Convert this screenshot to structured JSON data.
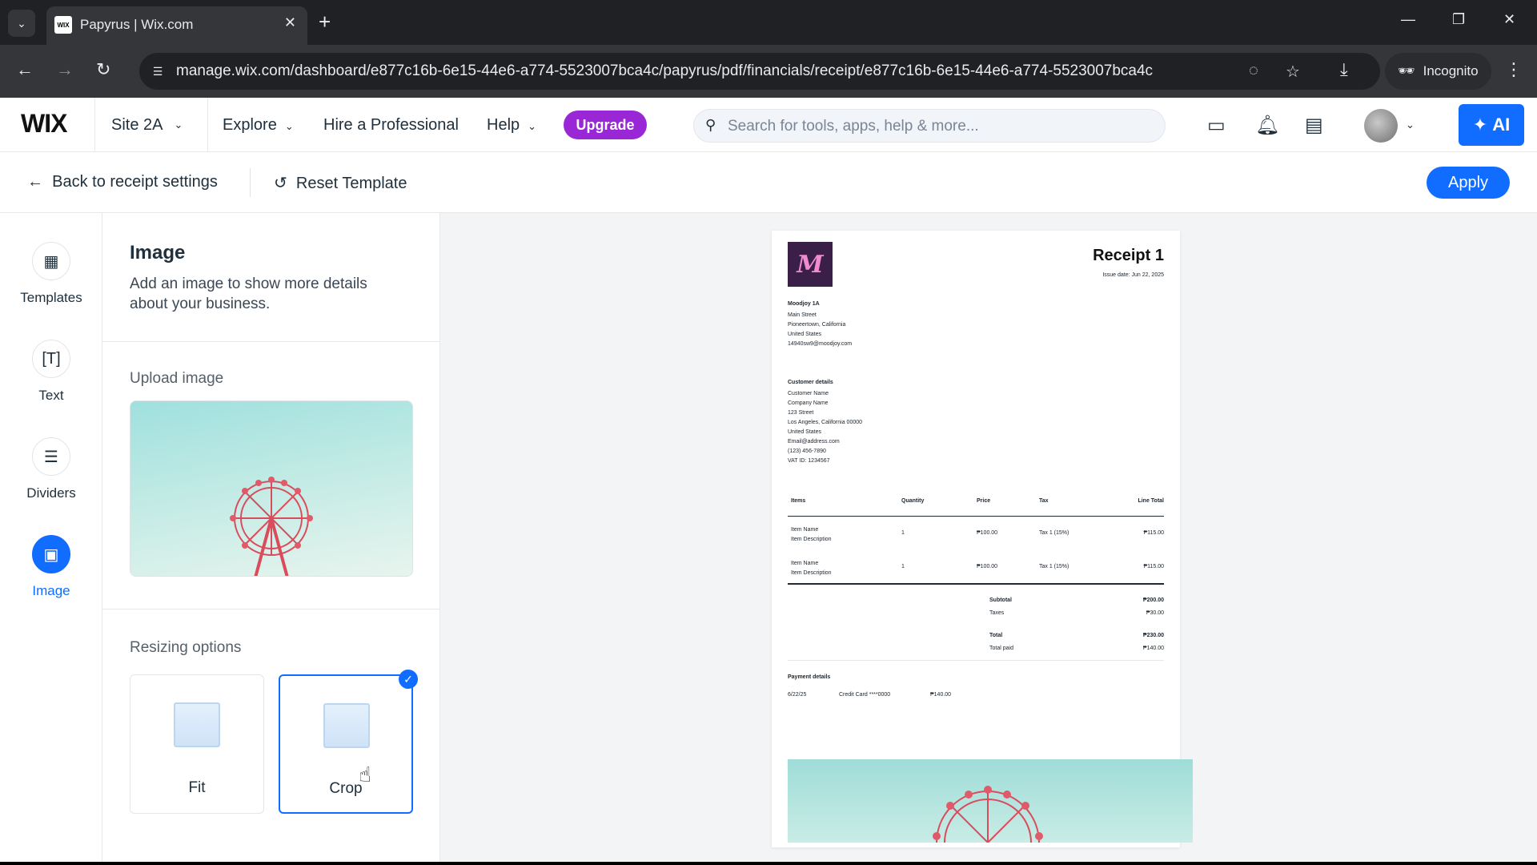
{
  "browser": {
    "tab_title": "Papyrus | Wix.com",
    "tab_favicon": "WIX",
    "url": "manage.wix.com/dashboard/e877c16b-6e15-44e6-a774-5523007bca4c/papyrus/pdf/financials/receipt/e877c16b-6e15-44e6-a774-5523007bca4c",
    "incognito_label": "Incognito"
  },
  "wix": {
    "logo": "WIX",
    "site_name": "Site 2A",
    "menu": {
      "explore": "Explore",
      "hire": "Hire a Professional",
      "help": "Help"
    },
    "upgrade": "Upgrade",
    "search_placeholder": "Search for tools, apps, help & more...",
    "ai_label": "AI",
    "colors": {
      "accent": "#116dff",
      "upgrade": "#9a27d5"
    }
  },
  "subheader": {
    "back": "Back to receipt settings",
    "reset": "Reset Template",
    "apply": "Apply"
  },
  "rail": {
    "items": [
      {
        "label": "Templates",
        "icon": "templates-icon"
      },
      {
        "label": "Text",
        "icon": "text-icon"
      },
      {
        "label": "Dividers",
        "icon": "dividers-icon"
      },
      {
        "label": "Image",
        "icon": "image-icon",
        "active": true
      }
    ]
  },
  "panel": {
    "title": "Image",
    "description": "Add an image to show more details about your business.",
    "upload_label": "Upload image",
    "resizing_label": "Resizing options",
    "options": [
      {
        "label": "Fit",
        "selected": false
      },
      {
        "label": "Crop",
        "selected": true
      }
    ]
  },
  "receipt": {
    "title": "Receipt 1",
    "issue_date": "Issue date: Jun 22, 2025",
    "business": {
      "name": "Moodjoy 1A",
      "lines": [
        "Main Street",
        "Pioneertown, California",
        "United States",
        "14940sw9@moodjoy.com"
      ]
    },
    "customer": {
      "heading": "Customer details",
      "lines": [
        "Customer Name",
        "Company Name",
        "123 Street",
        "Los Angeles, California 00000",
        "United States",
        "Email@address.com",
        "(123) 456-7890",
        "VAT ID: 1234567"
      ]
    },
    "table": {
      "headers": [
        "Items",
        "Quantity",
        "Price",
        "Tax",
        "Line Total"
      ],
      "rows": [
        {
          "name": "Item Name",
          "desc": "Item Description",
          "qty": "1",
          "price": "₱100.00",
          "tax": "Tax 1 (15%)",
          "total": "₱115.00"
        },
        {
          "name": "Item Name",
          "desc": "Item Description",
          "qty": "1",
          "price": "₱100.00",
          "tax": "Tax 1 (15%)",
          "total": "₱115.00"
        }
      ]
    },
    "totals": {
      "subtotal_label": "Subtotal",
      "subtotal": "₱200.00",
      "taxes_label": "Taxes",
      "taxes": "₱30.00",
      "total_label": "Total",
      "total": "₱230.00",
      "paid_label": "Total paid",
      "paid": "₱140.00"
    },
    "payment": {
      "heading": "Payment details",
      "date": "6/22/25",
      "method": "Credit Card ****0000",
      "amount": "₱140.00"
    }
  }
}
